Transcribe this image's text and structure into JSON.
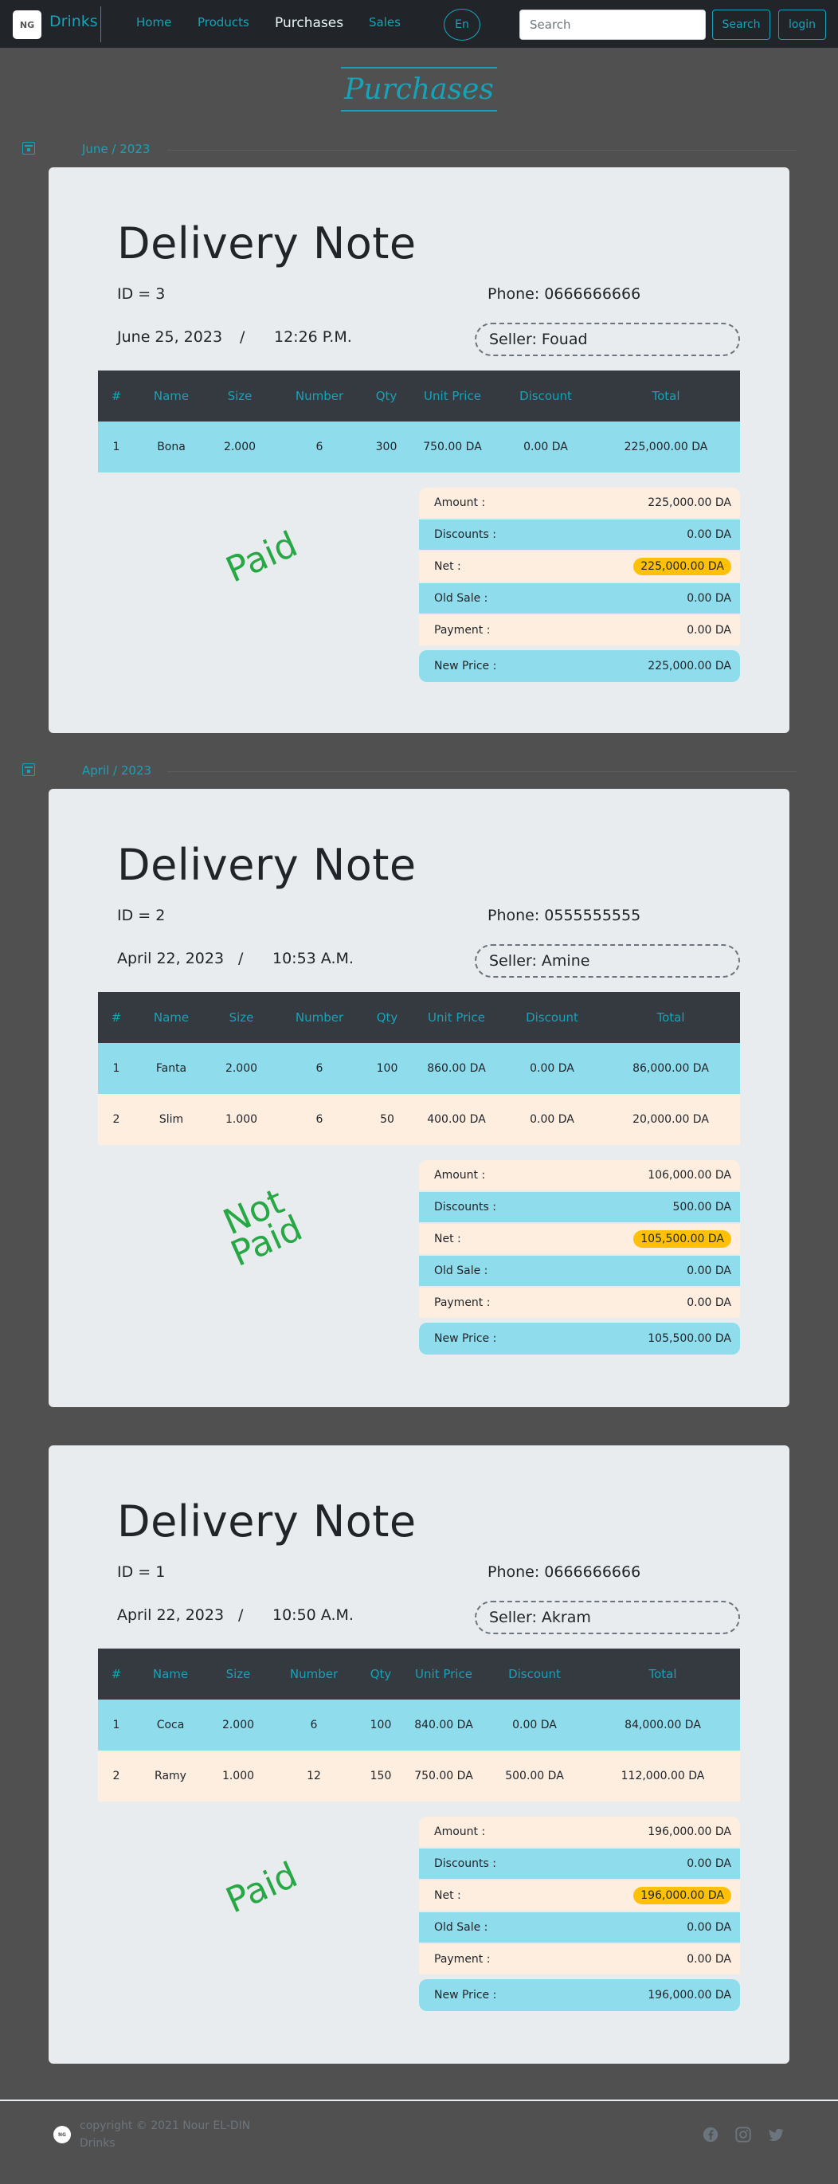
{
  "navbar": {
    "logo_text": "NG",
    "brand": "Drinks",
    "links": [
      "Home",
      "Products",
      "Purchases",
      "Sales"
    ],
    "language": "En",
    "search_placeholder": "Search",
    "search_button": "Search",
    "login_button": "login",
    "accent": "#17a2b8"
  },
  "page": {
    "title": "Purchases"
  },
  "labels": {
    "doc_title": "Delivery Note",
    "col_headers": [
      "#",
      "Name",
      "Size",
      "Number",
      "Qty",
      "Unit Price",
      "Discount",
      "Total"
    ],
    "amount": "Amount :",
    "discounts": "Discounts :",
    "net": "Net :",
    "old_sale": "Old Sale :",
    "payment": "Payment :",
    "new_price": "New Price :",
    "slash": "/"
  },
  "months": [
    "June / 2023",
    "April / 2023"
  ],
  "notes": [
    {
      "id": "ID = 3",
      "phone": "Phone: 0666666666",
      "date": "June 25, 2023",
      "time": "12:26 P.M.",
      "seller": "Seller: Fouad",
      "items": [
        [
          "1",
          "Bona",
          "2.000",
          "6",
          "300",
          "750.00 DA",
          "0.00 DA",
          "225,000.00 DA"
        ]
      ],
      "amount": "225,000.00 DA",
      "discounts": "0.00 DA",
      "net": "225,000.00 DA",
      "old_sale": "0.00 DA",
      "payment": "0.00 DA",
      "new_price": "225,000.00 DA",
      "status_line1": "Paid",
      "status_line2": ""
    },
    {
      "id": "ID = 2",
      "phone": "Phone: 0555555555",
      "date": "April 22, 2023",
      "time": "10:53 A.M.",
      "seller": "Seller: Amine",
      "items": [
        [
          "1",
          "Fanta",
          "2.000",
          "6",
          "100",
          "860.00 DA",
          "0.00 DA",
          "86,000.00 DA"
        ],
        [
          "2",
          "Slim",
          "1.000",
          "6",
          "50",
          "400.00 DA",
          "0.00 DA",
          "20,000.00 DA"
        ]
      ],
      "amount": "106,000.00 DA",
      "discounts": "500.00 DA",
      "net": "105,500.00 DA",
      "old_sale": "0.00 DA",
      "payment": "0.00 DA",
      "new_price": "105,500.00 DA",
      "status_line1": "Not",
      "status_line2": "Paid"
    },
    {
      "id": "ID = 1",
      "phone": "Phone: 0666666666",
      "date": "April 22, 2023",
      "time": "10:50 A.M.",
      "seller": "Seller: Akram",
      "items": [
        [
          "1",
          "Coca",
          "2.000",
          "6",
          "100",
          "840.00 DA",
          "0.00 DA",
          "84,000.00 DA"
        ],
        [
          "2",
          "Ramy",
          "1.000",
          "12",
          "150",
          "750.00 DA",
          "500.00 DA",
          "112,000.00 DA"
        ]
      ],
      "amount": "196,000.00 DA",
      "discounts": "0.00 DA",
      "net": "196,000.00 DA",
      "old_sale": "0.00 DA",
      "payment": "0.00 DA",
      "new_price": "196,000.00 DA",
      "status_line1": "Paid",
      "status_line2": ""
    }
  ],
  "footer": {
    "logo_text": "NG",
    "copyright": "copyright © 2021 Nour EL-DIN",
    "brand": "Drinks",
    "icons": [
      "facebook-icon",
      "instagram-icon",
      "twitter-icon"
    ]
  }
}
